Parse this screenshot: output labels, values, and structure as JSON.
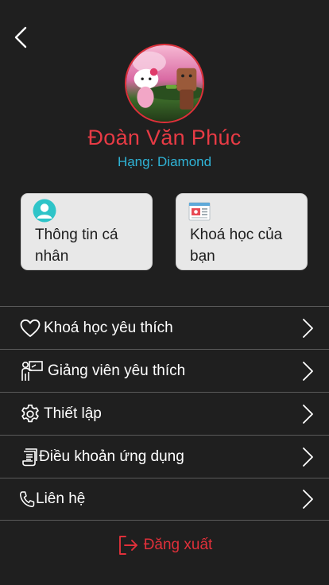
{
  "header": {
    "back_icon": "chevron-left-icon"
  },
  "profile": {
    "name": "Đoàn Văn Phúc",
    "rank": "Hạng: Diamond",
    "name_color": "#e83b45",
    "rank_color": "#2fb3d6"
  },
  "cards": [
    {
      "label": "Thông tin cá nhân",
      "icon": "user-avatar-icon"
    },
    {
      "label": "Khoá học của bạn",
      "icon": "course-icon"
    }
  ],
  "menu": [
    {
      "label": "Khoá học yêu thích",
      "icon": "heart-icon"
    },
    {
      "label": "Giảng viên yêu thích",
      "icon": "teacher-icon"
    },
    {
      "label": "Thiết lập",
      "icon": "gear-icon"
    },
    {
      "label": "Điều khoản ứng dụng",
      "icon": "document-icon"
    },
    {
      "label": "Liên hệ",
      "icon": "phone-icon"
    }
  ],
  "logout": {
    "label": "Đăng xuất",
    "icon": "logout-icon",
    "color": "#e0303a"
  }
}
